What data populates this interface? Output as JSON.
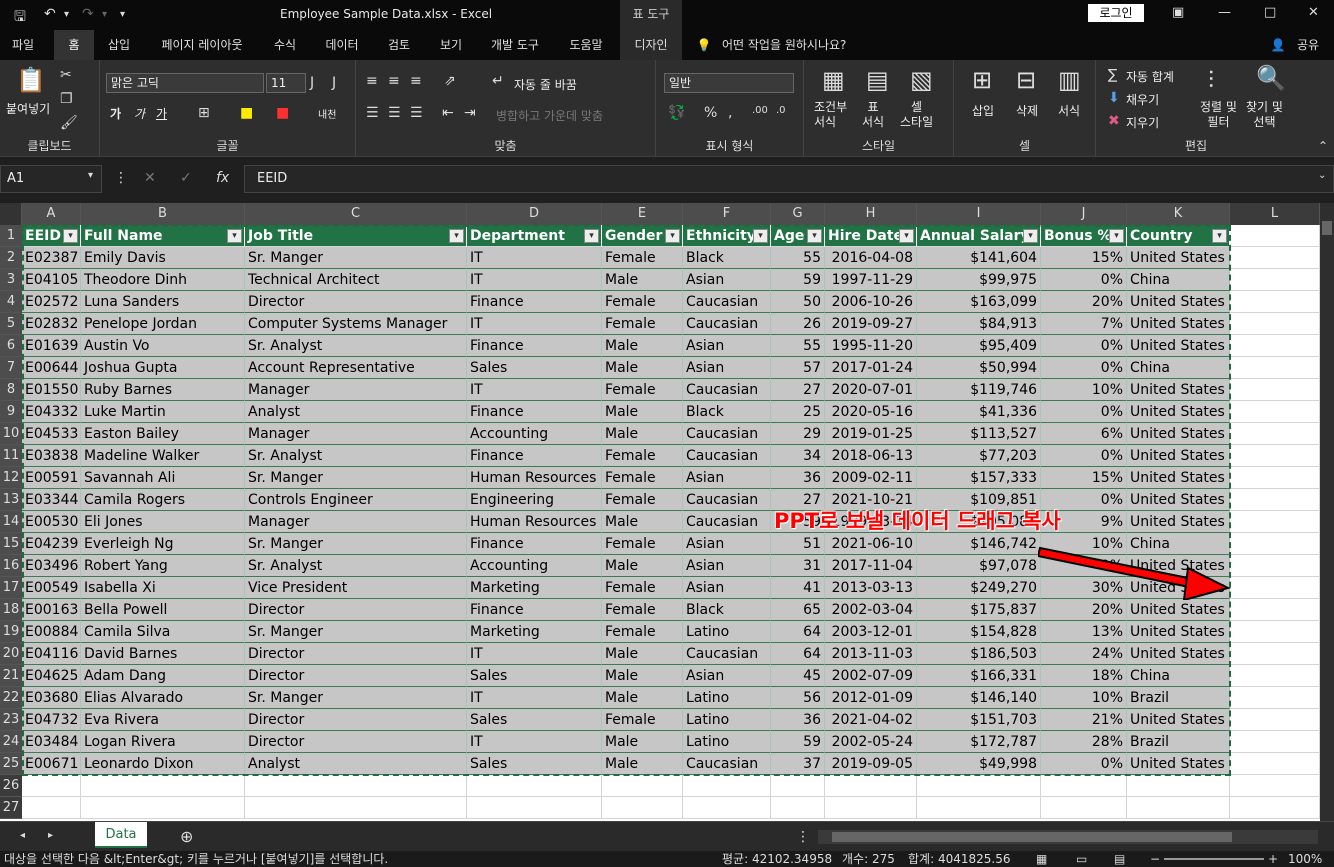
{
  "titlebar": {
    "title": "Employee Sample Data.xlsx  -  Excel",
    "context_tab": "표 도구",
    "login": "로그인"
  },
  "tabs": [
    "파일",
    "홈",
    "삽입",
    "페이지 레이아웃",
    "수식",
    "데이터",
    "검토",
    "보기",
    "개발 도구",
    "도움말",
    "디자인"
  ],
  "tell_me": "어떤 작업을 원하시나요?",
  "share": "공유",
  "ribbon": {
    "clipboard": {
      "paste": "붙여넣기",
      "label": "클립보드"
    },
    "font": {
      "name": "맑은 고딕",
      "size": "11",
      "bold": "가",
      "italic": "가",
      "underline": "가",
      "label": "글꼴",
      "phonetic": "내천"
    },
    "align": {
      "wrap": "자동 줄 바꿈",
      "merge": "병합하고 가운데 맞춤",
      "label": "맞춤"
    },
    "number": {
      "format": "일반",
      "label": "표시 형식"
    },
    "styles": {
      "cond": "조건부\n서식",
      "table": "표\n서식",
      "cell": "셀\n스타일",
      "label": "스타일"
    },
    "cells": {
      "insert": "삽입",
      "delete": "삭제",
      "format": "서식",
      "label": "셀"
    },
    "editing": {
      "autosum": "자동 합계",
      "fill": "채우기",
      "clear": "지우기",
      "sort": "정렬 및\n필터",
      "find": "찾기 및\n선택",
      "label": "편집"
    }
  },
  "formula": {
    "cell": "A1",
    "value": "EEID"
  },
  "columns": [
    "A",
    "B",
    "C",
    "D",
    "E",
    "F",
    "G",
    "H",
    "I",
    "J",
    "K",
    "L"
  ],
  "headers": [
    "EEID",
    "Full Name",
    "Job Title",
    "Department",
    "Gender",
    "Ethnicity",
    "Age",
    "Hire Date",
    "Annual Salary",
    "Bonus %",
    "Country"
  ],
  "rows": [
    [
      "E02387",
      "Emily Davis",
      "Sr. Manger",
      "IT",
      "Female",
      "Black",
      "55",
      "2016-04-08",
      "$141,604",
      "15%",
      "United States"
    ],
    [
      "E04105",
      "Theodore Dinh",
      "Technical Architect",
      "IT",
      "Male",
      "Asian",
      "59",
      "1997-11-29",
      "$99,975",
      "0%",
      "China"
    ],
    [
      "E02572",
      "Luna Sanders",
      "Director",
      "Finance",
      "Female",
      "Caucasian",
      "50",
      "2006-10-26",
      "$163,099",
      "20%",
      "United States"
    ],
    [
      "E02832",
      "Penelope Jordan",
      "Computer Systems Manager",
      "IT",
      "Female",
      "Caucasian",
      "26",
      "2019-09-27",
      "$84,913",
      "7%",
      "United States"
    ],
    [
      "E01639",
      "Austin Vo",
      "Sr. Analyst",
      "Finance",
      "Male",
      "Asian",
      "55",
      "1995-11-20",
      "$95,409",
      "0%",
      "United States"
    ],
    [
      "E00644",
      "Joshua Gupta",
      "Account Representative",
      "Sales",
      "Male",
      "Asian",
      "57",
      "2017-01-24",
      "$50,994",
      "0%",
      "China"
    ],
    [
      "E01550",
      "Ruby Barnes",
      "Manager",
      "IT",
      "Female",
      "Caucasian",
      "27",
      "2020-07-01",
      "$119,746",
      "10%",
      "United States"
    ],
    [
      "E04332",
      "Luke Martin",
      "Analyst",
      "Finance",
      "Male",
      "Black",
      "25",
      "2020-05-16",
      "$41,336",
      "0%",
      "United States"
    ],
    [
      "E04533",
      "Easton Bailey",
      "Manager",
      "Accounting",
      "Male",
      "Caucasian",
      "29",
      "2019-01-25",
      "$113,527",
      "6%",
      "United States"
    ],
    [
      "E03838",
      "Madeline Walker",
      "Sr. Analyst",
      "Finance",
      "Female",
      "Caucasian",
      "34",
      "2018-06-13",
      "$77,203",
      "0%",
      "United States"
    ],
    [
      "E00591",
      "Savannah Ali",
      "Sr. Manger",
      "Human Resources",
      "Female",
      "Asian",
      "36",
      "2009-02-11",
      "$157,333",
      "15%",
      "United States"
    ],
    [
      "E03344",
      "Camila Rogers",
      "Controls Engineer",
      "Engineering",
      "Female",
      "Caucasian",
      "27",
      "2021-10-21",
      "$109,851",
      "0%",
      "United States"
    ],
    [
      "E00530",
      "Eli Jones",
      "Manager",
      "Human Resources",
      "Male",
      "Caucasian",
      "59",
      "1999-03-14",
      "$105,086",
      "9%",
      "United States"
    ],
    [
      "E04239",
      "Everleigh Ng",
      "Sr. Manger",
      "Finance",
      "Female",
      "Asian",
      "51",
      "2021-06-10",
      "$146,742",
      "10%",
      "China"
    ],
    [
      "E03496",
      "Robert Yang",
      "Sr. Analyst",
      "Accounting",
      "Male",
      "Asian",
      "31",
      "2017-11-04",
      "$97,078",
      "0%",
      "United States"
    ],
    [
      "E00549",
      "Isabella Xi",
      "Vice President",
      "Marketing",
      "Female",
      "Asian",
      "41",
      "2013-03-13",
      "$249,270",
      "30%",
      "United States"
    ],
    [
      "E00163",
      "Bella Powell",
      "Director",
      "Finance",
      "Female",
      "Black",
      "65",
      "2002-03-04",
      "$175,837",
      "20%",
      "United States"
    ],
    [
      "E00884",
      "Camila Silva",
      "Sr. Manger",
      "Marketing",
      "Female",
      "Latino",
      "64",
      "2003-12-01",
      "$154,828",
      "13%",
      "United States"
    ],
    [
      "E04116",
      "David Barnes",
      "Director",
      "IT",
      "Male",
      "Caucasian",
      "64",
      "2013-11-03",
      "$186,503",
      "24%",
      "United States"
    ],
    [
      "E04625",
      "Adam Dang",
      "Director",
      "Sales",
      "Male",
      "Asian",
      "45",
      "2002-07-09",
      "$166,331",
      "18%",
      "China"
    ],
    [
      "E03680",
      "Elias Alvarado",
      "Sr. Manger",
      "IT",
      "Male",
      "Latino",
      "56",
      "2012-01-09",
      "$146,140",
      "10%",
      "Brazil"
    ],
    [
      "E04732",
      "Eva Rivera",
      "Director",
      "Sales",
      "Female",
      "Latino",
      "36",
      "2021-04-02",
      "$151,703",
      "21%",
      "United States"
    ],
    [
      "E03484",
      "Logan Rivera",
      "Director",
      "IT",
      "Male",
      "Latino",
      "59",
      "2002-05-24",
      "$172,787",
      "28%",
      "Brazil"
    ],
    [
      "E00671",
      "Leonardo Dixon",
      "Analyst",
      "Sales",
      "Male",
      "Caucasian",
      "37",
      "2019-09-05",
      "$49,998",
      "0%",
      "United States"
    ]
  ],
  "row_numbers": [
    "1",
    "2",
    "3",
    "4",
    "5",
    "6",
    "7",
    "8",
    "9",
    "10",
    "11",
    "12",
    "13",
    "14",
    "15",
    "16",
    "17",
    "18",
    "19",
    "20",
    "21",
    "22",
    "23",
    "24",
    "25",
    "26",
    "27"
  ],
  "sheet": {
    "name": "Data"
  },
  "status": {
    "message": "대상을 선택한 다음 &lt;Enter&gt; 키를 누르거나 [붙여넣기]를 선택합니다.",
    "average": "평균: 42102.34958",
    "count": "개수: 275",
    "sum": "합계: 4041825.56",
    "zoom": "100%"
  },
  "annotation": "PPT로 보낼 데이터 드래그 복사",
  "colors": {
    "header_green": "#217346",
    "selection": "#c6c6c6",
    "annotation": "#ff0000"
  }
}
